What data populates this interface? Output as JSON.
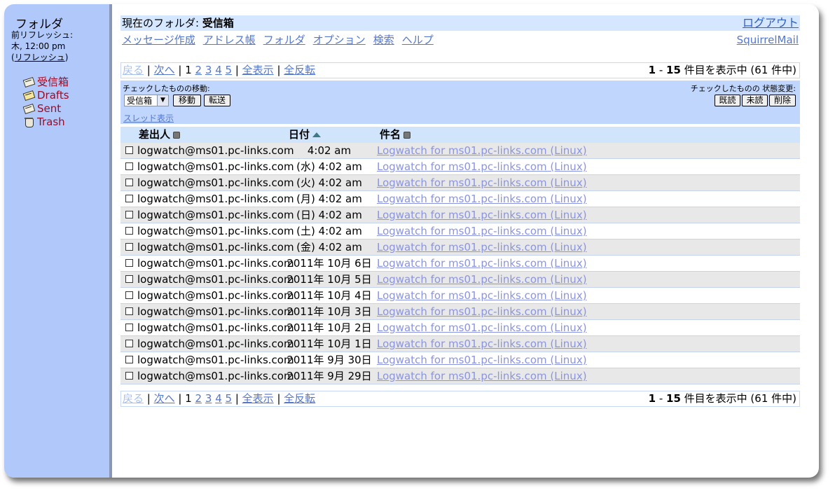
{
  "sidebar": {
    "title": "フォルダ",
    "last_refresh_label": "前リフレッシュ:",
    "last_refresh_time": "木, 12:00 pm",
    "refresh_open": "(",
    "refresh_link": "リフレッシュ",
    "refresh_close": ")",
    "folders": [
      {
        "label": "受信箱",
        "icon": "inbox-icon"
      },
      {
        "label": "Drafts",
        "icon": "drafts-icon"
      },
      {
        "label": "Sent",
        "icon": "sent-icon"
      },
      {
        "label": "Trash",
        "icon": "trash-icon"
      }
    ]
  },
  "header": {
    "current_folder_label": "現在のフォルダ: ",
    "current_folder": "受信箱",
    "logout": "ログアウト"
  },
  "nav": {
    "items": [
      "メッセージ作成",
      "アドレス帳",
      "フォルダ",
      "オプション",
      "検索",
      "ヘルプ"
    ],
    "brand": "SquirrelMail"
  },
  "pager": {
    "prev": "戻る",
    "next": "次へ",
    "current_page": "1",
    "pages": [
      "2",
      "3",
      "4",
      "5"
    ],
    "show_all": "全表示",
    "invert": "全反転",
    "count_start": "1",
    "count_dash": " - ",
    "count_end": "15",
    "count_suffix": " 件目を表示中 (61 件中)"
  },
  "controls": {
    "move_label": "チェックしたものの移動:",
    "state_label": "チェックしたものの 状態変更:",
    "move_target": "受信箱",
    "move_button": "移動",
    "forward_button": "転送",
    "read_button": "既読",
    "unread_button": "未読",
    "delete_button": "削除",
    "thread_view": "スレッド表示"
  },
  "table": {
    "col_from": "差出人",
    "col_date": "日付",
    "col_subject": "件名",
    "rows": [
      {
        "from": "logwatch@ms01.pc-links.com",
        "date": "4:02 am",
        "subject": "Logwatch for ms01.pc-links.com (Linux)"
      },
      {
        "from": "logwatch@ms01.pc-links.com",
        "date": "(水) 4:02 am",
        "subject": "Logwatch for ms01.pc-links.com (Linux)"
      },
      {
        "from": "logwatch@ms01.pc-links.com",
        "date": "(火) 4:02 am",
        "subject": "Logwatch for ms01.pc-links.com (Linux)"
      },
      {
        "from": "logwatch@ms01.pc-links.com",
        "date": "(月) 4:02 am",
        "subject": "Logwatch for ms01.pc-links.com (Linux)"
      },
      {
        "from": "logwatch@ms01.pc-links.com",
        "date": "(日) 4:02 am",
        "subject": "Logwatch for ms01.pc-links.com (Linux)"
      },
      {
        "from": "logwatch@ms01.pc-links.com",
        "date": "(土) 4:02 am",
        "subject": "Logwatch for ms01.pc-links.com (Linux)"
      },
      {
        "from": "logwatch@ms01.pc-links.com",
        "date": "(金) 4:02 am",
        "subject": "Logwatch for ms01.pc-links.com (Linux)"
      },
      {
        "from": "logwatch@ms01.pc-links.com",
        "date": "2011年 10月 6日",
        "subject": "Logwatch for ms01.pc-links.com (Linux)"
      },
      {
        "from": "logwatch@ms01.pc-links.com",
        "date": "2011年 10月 5日",
        "subject": "Logwatch for ms01.pc-links.com (Linux)"
      },
      {
        "from": "logwatch@ms01.pc-links.com",
        "date": "2011年 10月 4日",
        "subject": "Logwatch for ms01.pc-links.com (Linux)"
      },
      {
        "from": "logwatch@ms01.pc-links.com",
        "date": "2011年 10月 3日",
        "subject": "Logwatch for ms01.pc-links.com (Linux)"
      },
      {
        "from": "logwatch@ms01.pc-links.com",
        "date": "2011年 10月 2日",
        "subject": "Logwatch for ms01.pc-links.com (Linux)"
      },
      {
        "from": "logwatch@ms01.pc-links.com",
        "date": "2011年 10月 1日",
        "subject": "Logwatch for ms01.pc-links.com (Linux)"
      },
      {
        "from": "logwatch@ms01.pc-links.com",
        "date": "2011年 9月 30日",
        "subject": "Logwatch for ms01.pc-links.com (Linux)"
      },
      {
        "from": "logwatch@ms01.pc-links.com",
        "date": "2011年 9月 29日",
        "subject": "Logwatch for ms01.pc-links.com (Linux)"
      }
    ]
  }
}
